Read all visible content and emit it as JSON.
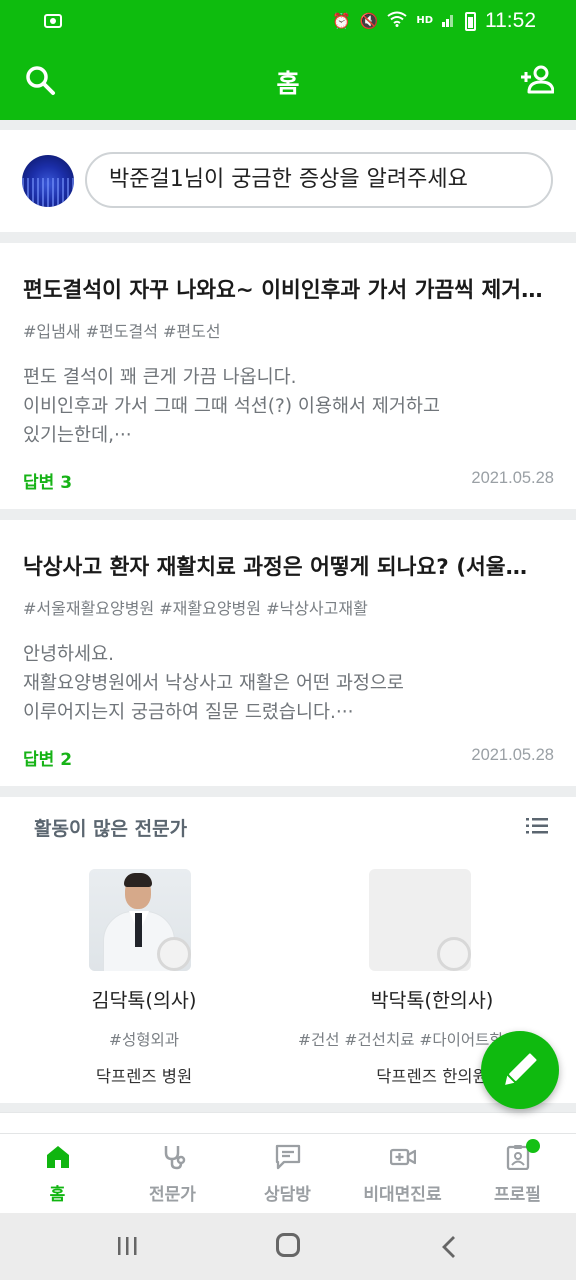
{
  "status_bar": {
    "time": "11:52",
    "hd_label": "HD"
  },
  "app_bar": {
    "title": "홈",
    "icons": [
      "search-icon",
      "add-user-icon"
    ]
  },
  "ask": {
    "placeholder": "박준걸1님이 궁금한 증상을 알려주세요"
  },
  "questions": [
    {
      "title": "편도결석이 자꾸 나와요~ 이비인후과 가서 가끔씩 제거하는데 근본적인 치료 방법이 있을까요?",
      "tags": "#입냄새 #편도결석 #편도선",
      "body_line1": "편도 결석이 꽤 큰게 가끔 나옵니다.",
      "body_line2": "이비인후과 가서 그때 그때 석션(?) 이용해서 제거하고",
      "body_line3": "있기는한데,···",
      "answers": "답변 3",
      "date": "2021.05.28"
    },
    {
      "title": "낙상사고 환자 재활치료 과정은 어떻게 되나요? (서울재활요양병원)",
      "tags": "#서울재활요양병원 #재활요양병원 #낙상사고재활",
      "body_line1": "안녕하세요.",
      "body_line2": "재활요양병원에서 낙상사고 재활은 어떤 과정으로",
      "body_line3": "이루어지는지 궁금하여 질문 드렸습니다.···",
      "answers": "답변 2",
      "date": "2021.05.28"
    }
  ],
  "experts": {
    "title": "활동이 많은 전문가",
    "items": [
      {
        "name": "김닥톡(의사)",
        "tags": "#성형외과",
        "hospital": "닥프렌즈 병원"
      },
      {
        "name": "박닥톡(한의사)",
        "tags": "#건선 #건선치료 #다이어트한약",
        "hospital": "닥프렌즈 한의원"
      }
    ]
  },
  "bottom_nav": [
    {
      "label": "홈",
      "icon": "home-icon",
      "active": true
    },
    {
      "label": "전문가",
      "icon": "stethoscope-icon"
    },
    {
      "label": "상담방",
      "icon": "chat-icon"
    },
    {
      "label": "비대면진료",
      "icon": "video-icon"
    },
    {
      "label": "프로필",
      "icon": "profile-icon"
    }
  ],
  "colors": {
    "brand_green": "#0ebc0e",
    "answer_green": "#17b317",
    "background": "#eceeef"
  }
}
